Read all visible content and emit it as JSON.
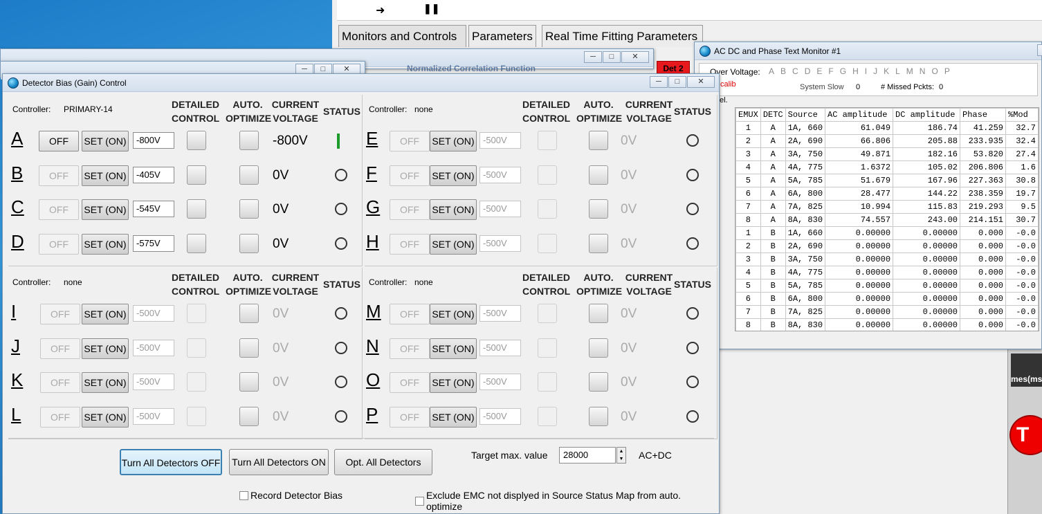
{
  "main_app": {
    "tabs": [
      "Monitors and Controls",
      "Parameters",
      "Real Time Fitting Parameters"
    ],
    "det_badge": "Det 2",
    "right_partial": "mes(ms"
  },
  "bg_window": {
    "title_partial": "Normalized Correlation Function"
  },
  "monitor": {
    "title": "AC DC and Phase Text Monitor #1",
    "over_voltage_label": "Over Voltage:",
    "ov_letters": [
      "A",
      "B",
      "C",
      "D",
      "E",
      "F",
      "G",
      "H",
      "I",
      "J",
      "K",
      "L",
      "M",
      "N",
      "O",
      "P"
    ],
    "calib_text": "calib",
    "system_slow_label": "System Slow",
    "system_slow_value": "0",
    "missed_label": "# Missed Pckts:",
    "missed_value": "0",
    "side_text": "el.",
    "headers": [
      "EMUX",
      "DETC",
      "Source",
      "AC amplitude",
      "DC amplitude",
      "Phase",
      "%Mod"
    ],
    "rows": [
      [
        "1",
        "A",
        "1A, 660",
        "61.049",
        "186.74",
        "41.259",
        "32.7"
      ],
      [
        "2",
        "A",
        "2A, 690",
        "66.806",
        "205.88",
        "233.935",
        "32.4"
      ],
      [
        "3",
        "A",
        "3A, 750",
        "49.871",
        "182.16",
        "53.820",
        "27.4"
      ],
      [
        "4",
        "A",
        "4A, 775",
        "1.6372",
        "105.02",
        "206.806",
        "1.6"
      ],
      [
        "5",
        "A",
        "5A, 785",
        "51.679",
        "167.96",
        "227.363",
        "30.8"
      ],
      [
        "6",
        "A",
        "6A, 800",
        "28.477",
        "144.22",
        "238.359",
        "19.7"
      ],
      [
        "7",
        "A",
        "7A, 825",
        "10.994",
        "115.83",
        "219.293",
        "9.5"
      ],
      [
        "8",
        "A",
        "8A, 830",
        "74.557",
        "243.00",
        "214.151",
        "30.7"
      ],
      [
        "1",
        "B",
        "1A, 660",
        "0.00000",
        "0.00000",
        "0.000",
        "-0.0"
      ],
      [
        "2",
        "B",
        "2A, 690",
        "0.00000",
        "0.00000",
        "0.000",
        "-0.0"
      ],
      [
        "3",
        "B",
        "3A, 750",
        "0.00000",
        "0.00000",
        "0.000",
        "-0.0"
      ],
      [
        "4",
        "B",
        "4A, 775",
        "0.00000",
        "0.00000",
        "0.000",
        "-0.0"
      ],
      [
        "5",
        "B",
        "5A, 785",
        "0.00000",
        "0.00000",
        "0.000",
        "-0.0"
      ],
      [
        "6",
        "B",
        "6A, 800",
        "0.00000",
        "0.00000",
        "0.000",
        "-0.0"
      ],
      [
        "7",
        "B",
        "7A, 825",
        "0.00000",
        "0.00000",
        "0.000",
        "-0.0"
      ],
      [
        "8",
        "B",
        "8A, 830",
        "0.00000",
        "0.00000",
        "0.000",
        "-0.0"
      ]
    ]
  },
  "bias": {
    "title": "Detector Bias (Gain) Control",
    "headers": {
      "detailed1": "DETAILED",
      "detailed2": "CONTROL",
      "auto1": "AUTO.",
      "auto2": "OPTIMIZE",
      "current1": "CURRENT",
      "current2": "VOLTAGE",
      "status": "STATUS"
    },
    "controller_label": "Controller:",
    "off_label": "OFF",
    "set_label": "SET (ON)",
    "groups": [
      {
        "controller": "PRIMARY-14",
        "detectors": [
          {
            "letter": "A",
            "setpoint": "-800V",
            "current": "-800V",
            "on": true,
            "enabled": true
          },
          {
            "letter": "B",
            "setpoint": "-405V",
            "current": "0V",
            "on": false,
            "enabled": true
          },
          {
            "letter": "C",
            "setpoint": "-545V",
            "current": "0V",
            "on": false,
            "enabled": true
          },
          {
            "letter": "D",
            "setpoint": "-575V",
            "current": "0V",
            "on": false,
            "enabled": true
          }
        ]
      },
      {
        "controller": "none",
        "detectors": [
          {
            "letter": "E",
            "setpoint": "-500V",
            "current": "0V",
            "on": false,
            "enabled": false
          },
          {
            "letter": "F",
            "setpoint": "-500V",
            "current": "0V",
            "on": false,
            "enabled": false
          },
          {
            "letter": "G",
            "setpoint": "-500V",
            "current": "0V",
            "on": false,
            "enabled": false
          },
          {
            "letter": "H",
            "setpoint": "-500V",
            "current": "0V",
            "on": false,
            "enabled": false
          }
        ]
      },
      {
        "controller": "none",
        "detectors": [
          {
            "letter": "I",
            "setpoint": "-500V",
            "current": "0V",
            "on": false,
            "enabled": false
          },
          {
            "letter": "J",
            "setpoint": "-500V",
            "current": "0V",
            "on": false,
            "enabled": false
          },
          {
            "letter": "K",
            "setpoint": "-500V",
            "current": "0V",
            "on": false,
            "enabled": false
          },
          {
            "letter": "L",
            "setpoint": "-500V",
            "current": "0V",
            "on": false,
            "enabled": false
          }
        ]
      },
      {
        "controller": "none",
        "detectors": [
          {
            "letter": "M",
            "setpoint": "-500V",
            "current": "0V",
            "on": false,
            "enabled": false
          },
          {
            "letter": "N",
            "setpoint": "-500V",
            "current": "0V",
            "on": false,
            "enabled": false
          },
          {
            "letter": "O",
            "setpoint": "-500V",
            "current": "0V",
            "on": false,
            "enabled": false
          },
          {
            "letter": "P",
            "setpoint": "-500V",
            "current": "0V",
            "on": false,
            "enabled": false
          }
        ]
      }
    ],
    "buttons": {
      "all_off": "Turn All Detectors OFF",
      "all_on": "Turn All Detectors ON",
      "opt_all": "Opt. All Detectors"
    },
    "target_label": "Target max. value",
    "target_value": "28000",
    "target_unit": "AC+DC",
    "record_label": "Record Detector Bias",
    "exclude_label": "Exclude EMC not displyed in Source Status Map from auto. optimize"
  }
}
